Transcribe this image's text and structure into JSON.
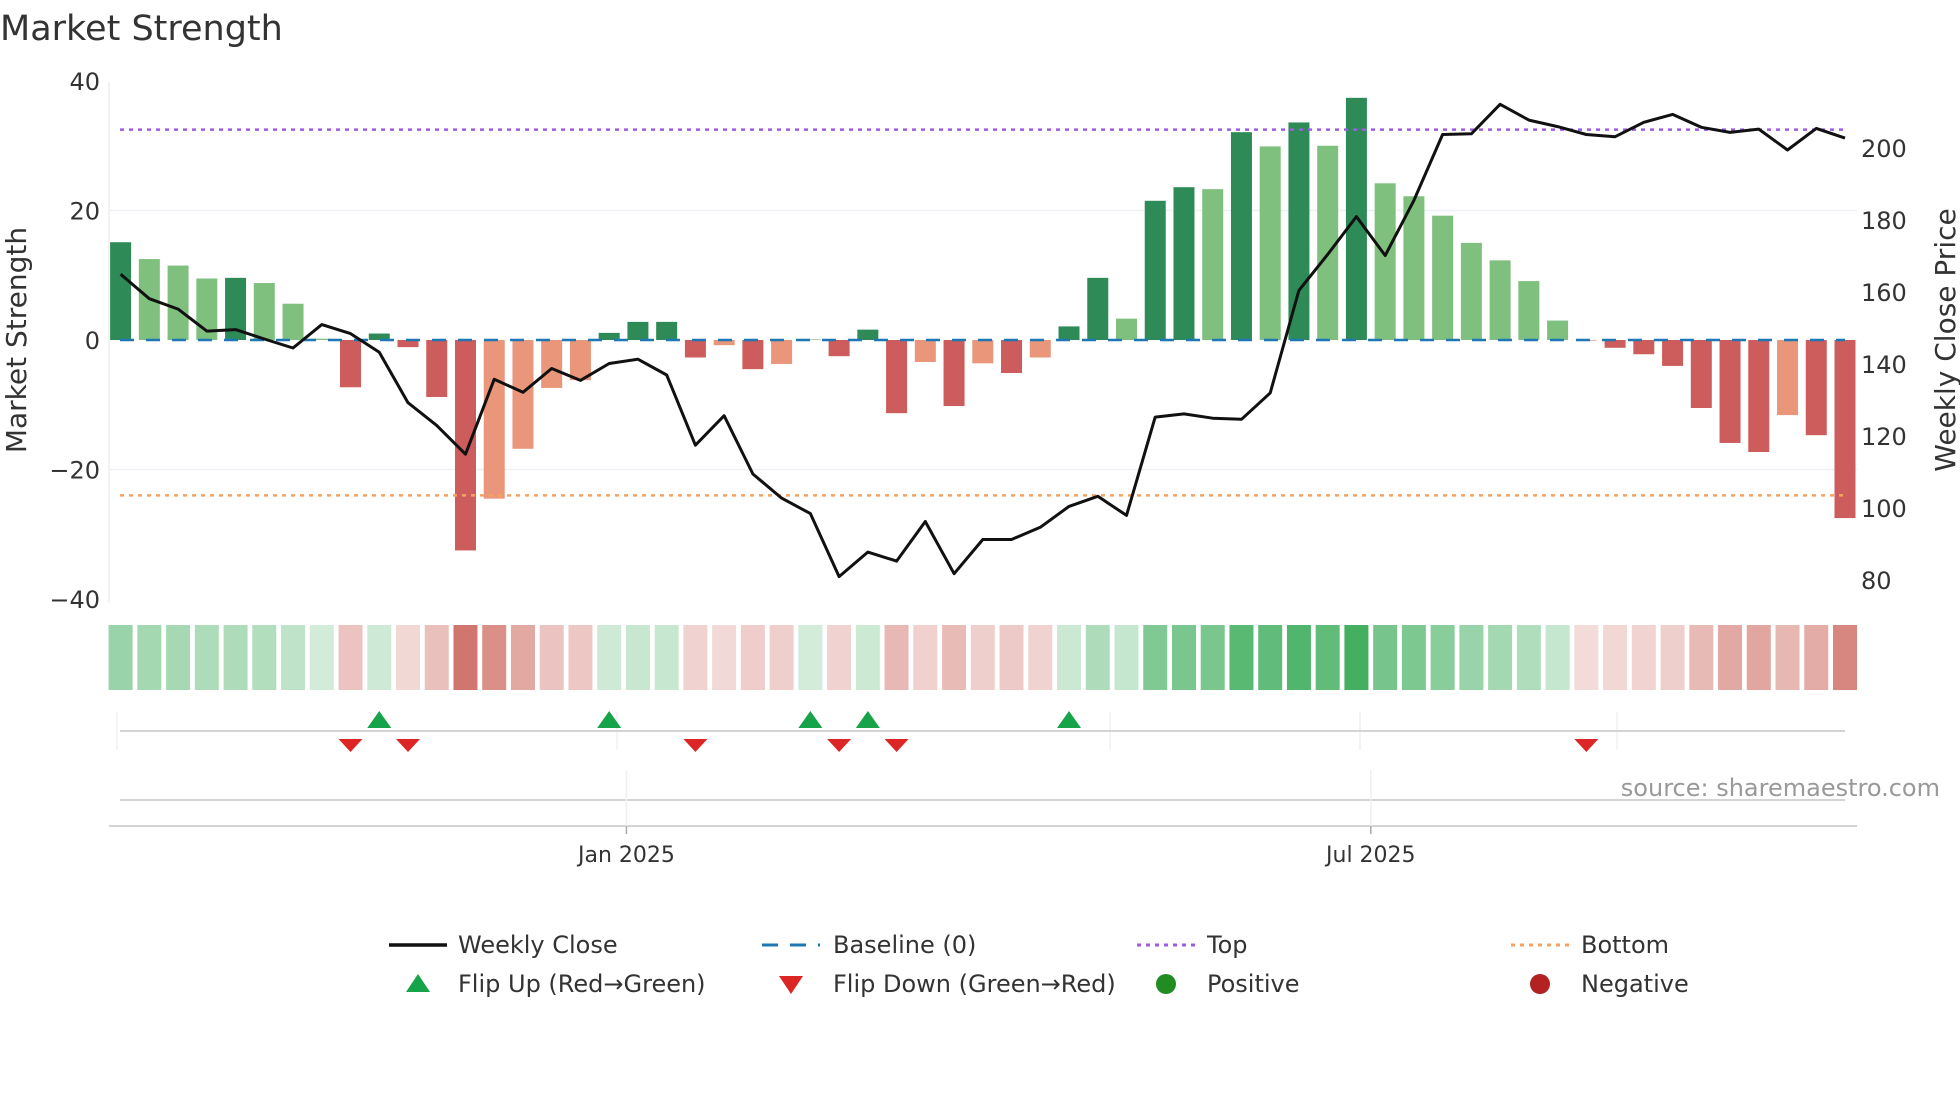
{
  "chart_data": {
    "type": "bar",
    "title": "Market Strength",
    "ylabel": "Market Strength",
    "y2label": "Weekly Close Price",
    "ylim": [
      -40,
      40
    ],
    "y2lim": [
      70,
      215
    ],
    "yticks": [
      "40",
      "20",
      "0",
      "−20",
      "−40"
    ],
    "ytick_values": [
      40,
      20,
      0,
      -20,
      -40
    ],
    "y2ticks": [
      "200",
      "180",
      "160",
      "140",
      "120",
      "100",
      "80"
    ],
    "y2tick_values": [
      200,
      180,
      160,
      140,
      120,
      100,
      80
    ],
    "xticks": [
      {
        "label": "Jan 2025",
        "index": 17.6
      },
      {
        "label": "Jul 2025",
        "index": 43.5
      }
    ],
    "grid": true,
    "top_level": 32.5,
    "bottom_level": -24,
    "strength": [
      15.1,
      12.5,
      11.5,
      9.5,
      9.6,
      8.8,
      5.6,
      0.2,
      -7.3,
      1.0,
      -1.1,
      -8.8,
      -32.5,
      -24.5,
      -16.8,
      -7.4,
      -6.2,
      1.1,
      2.8,
      2.8,
      -2.7,
      -0.8,
      -4.5,
      -3.7,
      0.1,
      -2.5,
      1.6,
      -11.3,
      -3.4,
      -10.2,
      -3.6,
      -5.1,
      -2.7,
      2.1,
      9.6,
      3.3,
      21.5,
      23.6,
      23.3,
      32.1,
      29.9,
      33.6,
      30.0,
      37.4,
      24.2,
      22.2,
      19.2,
      15.0,
      12.3,
      9.1,
      3.0,
      -0.1,
      -1.2,
      -2.2,
      -4.0,
      -10.5,
      -15.9,
      -17.3,
      -11.6,
      -14.7,
      -27.5
    ],
    "strength_shade": [
      "dark",
      "light",
      "light",
      "light",
      "dark",
      "light",
      "light",
      "light",
      "dark",
      "dark",
      "dark",
      "dark",
      "dark",
      "light",
      "light",
      "light",
      "light",
      "dark",
      "dark",
      "dark",
      "dark",
      "light",
      "dark",
      "light",
      "light",
      "dark",
      "dark",
      "dark",
      "light",
      "dark",
      "light",
      "dark",
      "light",
      "dark",
      "dark",
      "light",
      "dark",
      "dark",
      "light",
      "dark",
      "light",
      "dark",
      "light",
      "dark",
      "light",
      "light",
      "light",
      "light",
      "light",
      "light",
      "light",
      "light",
      "dark",
      "dark",
      "dark",
      "dark",
      "dark",
      "dark",
      "light",
      "dark",
      "dark"
    ],
    "weekly_close": [
      165,
      158.2,
      155.3,
      149.2,
      149.6,
      147,
      144.5,
      151,
      148.5,
      143.3,
      129.3,
      123,
      115,
      135.8,
      132.2,
      138.8,
      135.5,
      140.2,
      141.4,
      137,
      117.5,
      125.7,
      109.5,
      102.8,
      98.5,
      81,
      87.8,
      85.3,
      96.3,
      81.8,
      91.3,
      91.3,
      94.7,
      100.5,
      103.3,
      98,
      125.3,
      126.2,
      125,
      124.7,
      132,
      160.5,
      170.5,
      181,
      170.2,
      185.5,
      203.8,
      204,
      212.2,
      207.8,
      206,
      203.8,
      203.2,
      207.2,
      209.4,
      205.8,
      204.4,
      205.3,
      199.5,
      205.5,
      202.8
    ],
    "flip_up_indices": [
      9,
      17,
      24,
      26,
      33
    ],
    "flip_down_indices": [
      8,
      10,
      20,
      25,
      27,
      51
    ],
    "legend": {
      "placement": "bottom",
      "items": [
        {
          "label": "Weekly Close",
          "kind": "line"
        },
        {
          "label": "Baseline (0)",
          "kind": "dash"
        },
        {
          "label": "Top",
          "kind": "dot"
        },
        {
          "label": "Bottom",
          "kind": "dot"
        },
        {
          "label": "Flip Up (Red→Green)",
          "kind": "up"
        },
        {
          "label": "Flip Down (Green→Red)",
          "kind": "down"
        },
        {
          "label": "Positive",
          "kind": "circle"
        },
        {
          "label": "Negative",
          "kind": "circle"
        }
      ]
    },
    "source": "source: sharemaestro.com"
  },
  "colors": {
    "dark_green": "#2e8b57",
    "light_green": "#7fc07f",
    "dark_red": "#cd5c5c",
    "light_red": "#e9967a",
    "price": "#111111",
    "baseline": "#1f77b4",
    "top": "#9b5de5",
    "bottom": "#f4a261",
    "flip_up": "#16a34a",
    "flip_down": "#dc2626",
    "positive": "#228b22",
    "negative": "#b22222"
  }
}
